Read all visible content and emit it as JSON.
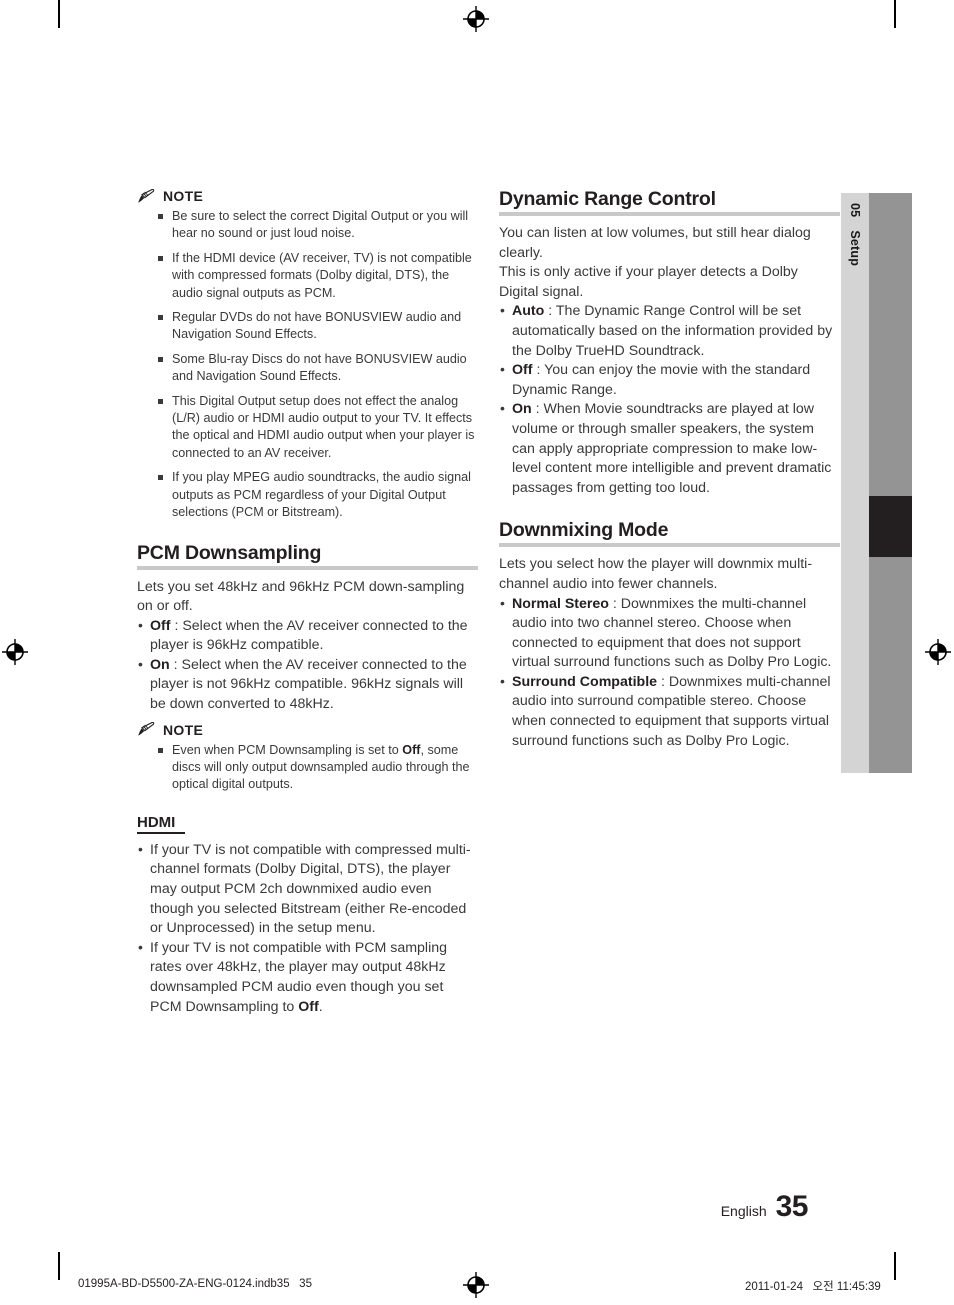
{
  "side_tab": {
    "number": "05",
    "label": "Setup"
  },
  "left_column": {
    "note_1": {
      "title": "NOTE",
      "items": [
        "Be sure to select the correct Digital Output or you will hear no sound or just loud noise.",
        "If the HDMI device (AV receiver, TV) is not compatible with compressed formats (Dolby digital, DTS), the audio signal outputs as PCM.",
        "Regular DVDs do not have BONUSVIEW audio and Navigation Sound Effects.",
        "Some Blu-ray Discs do not have BONUSVIEW audio and Navigation Sound Effects.",
        "This Digital Output setup does not effect the analog (L/R) audio or HDMI audio output to your TV. It effects the optical and HDMI audio output when your player is connected to an AV receiver.",
        "If you play MPEG audio soundtracks, the audio signal outputs as PCM regardless of your Digital Output selections (PCM or Bitstream)."
      ]
    },
    "pcm_downsampling": {
      "heading": "PCM Downsampling",
      "intro": "Lets you set 48kHz and 96kHz PCM down-sampling on or off.",
      "bullets": [
        {
          "term": "Off",
          "text": " : Select when the AV receiver connected to the player is 96kHz compatible."
        },
        {
          "term": "On",
          "text": " : Select when the AV receiver connected to the player is not 96kHz compatible. 96kHz signals will be down converted to 48kHz."
        }
      ]
    },
    "note_2": {
      "title": "NOTE",
      "item_prefix": "Even when PCM Downsampling is set to ",
      "item_bold": "Off",
      "item_suffix": ", some discs will only output downsampled audio through the optical digital outputs."
    },
    "hdmi": {
      "heading": "HDMI",
      "bullet_1": "If your TV is not compatible with compressed multi-channel formats (Dolby Digital, DTS), the player may output PCM 2ch downmixed audio even though you selected Bitstream (either Re-encoded or Unprocessed) in the setup menu.",
      "bullet_2_prefix": "If your TV is not compatible with PCM sampling rates over 48kHz, the player may output 48kHz downsampled PCM audio even though you set PCM Downsampling to ",
      "bullet_2_bold": "Off",
      "bullet_2_suffix": "."
    }
  },
  "right_column": {
    "dynamic_range_control": {
      "heading": "Dynamic Range Control",
      "intro_1": "You can listen at low volumes, but still hear dialog clearly.",
      "intro_2": "This is only active if your player detects a Dolby Digital signal.",
      "bullets": [
        {
          "term": "Auto",
          "text": " : The Dynamic Range Control will be set automatically based on the information provided by the Dolby TrueHD Soundtrack."
        },
        {
          "term": "Off",
          "text": " : You can enjoy the movie with the standard Dynamic Range."
        },
        {
          "term": "On",
          "text": " : When Movie soundtracks are played at low volume or through smaller speakers, the system can apply appropriate compression to make low-level content more intelligible and prevent dramatic passages from getting too loud."
        }
      ]
    },
    "downmixing_mode": {
      "heading": "Downmixing Mode",
      "intro": "Lets you select how the player will downmix multi-channel audio into fewer channels.",
      "bullets": [
        {
          "term": "Normal Stereo",
          "text": " : Downmixes the multi-channel audio into two channel stereo. Choose when connected to equipment that does not support virtual surround functions such as Dolby Pro Logic."
        },
        {
          "term": "Surround Compatible",
          "text": " : Downmixes multi-channel audio into surround compatible stereo. Choose when connected to equipment that supports virtual surround functions such as Dolby Pro Logic."
        }
      ]
    }
  },
  "page_footer": {
    "language": "English",
    "page_number": "35"
  },
  "print_footer": {
    "file_info": "01995A-BD-D5500-ZA-ENG-0124.indb35   35",
    "date_time": "2011-01-24   오전 11:45:39"
  },
  "colors": {
    "text": "#231f20",
    "body_text": "#3a3a3a",
    "tab_light": "#d4d4d4",
    "tab_gray": "#949494",
    "tab_active": "#231f20",
    "rule_gray": "#c9c9c9"
  }
}
